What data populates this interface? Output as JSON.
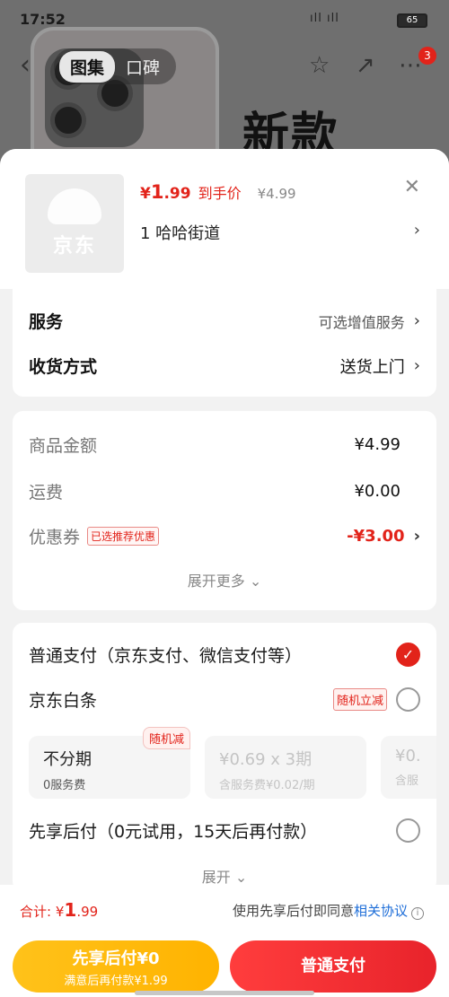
{
  "status": {
    "time": "17:52",
    "signal": "ıll ıll",
    "battery": "65"
  },
  "nav": {
    "tabs": [
      "图集",
      "口碑"
    ],
    "badge": "3"
  },
  "background": {
    "headline": "新款"
  },
  "product": {
    "price_symbol": "¥",
    "price_int": "1",
    "price_dec": ".99",
    "price_label": "到手价",
    "original_price": "¥4.99",
    "variant": "1  哈哈街道"
  },
  "delivery": {
    "service_label": "服务",
    "service_value": "可选增值服务",
    "shipping_label": "收货方式",
    "shipping_value": "送货上门"
  },
  "amounts": {
    "goods_label": "商品金额",
    "goods_value": "¥4.99",
    "freight_label": "运费",
    "freight_value": "¥0.00",
    "coupon_label": "优惠券",
    "coupon_tag": "已选推荐优惠",
    "coupon_value": "-¥3.00",
    "expand": "展开更多"
  },
  "payment": {
    "normal": "普通支付（京东支付、微信支付等）",
    "baitiao": "京东白条",
    "baitiao_tag": "随机立减",
    "installments": [
      {
        "title": "不分期",
        "sub": "0服务费",
        "flag": "随机减"
      },
      {
        "title": "¥0.69 x 3期",
        "sub": "含服务费¥0.02/期"
      },
      {
        "title": "¥0.",
        "sub": "含服"
      }
    ],
    "bnpl": "先享后付（0元试用，15天后再付款）",
    "expand": "展开"
  },
  "footer": {
    "total_label": "合计:",
    "total_symbol": "¥",
    "total_int": "1",
    "total_dec": ".99",
    "agree_text": "使用先享后付即同意",
    "agree_link": "相关协议",
    "btn_bnpl_main": "先享后付¥0",
    "btn_bnpl_sub": "满意后再付款¥1.99",
    "btn_pay": "普通支付"
  },
  "colors": {
    "accent": "#e2231a",
    "yellow": "#ffb300",
    "link": "#1e6ed8"
  }
}
